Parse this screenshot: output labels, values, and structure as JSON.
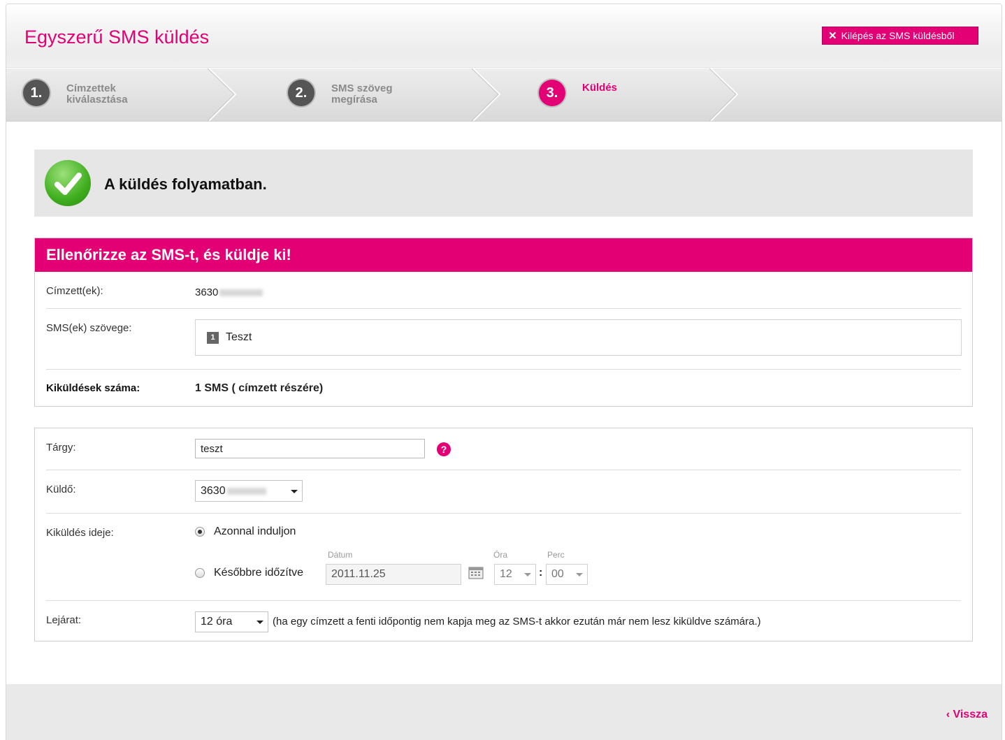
{
  "header": {
    "title": "Egyszerű SMS küldés",
    "exit_label": "Kilépés az SMS küldésből"
  },
  "steps": [
    {
      "number": "1.",
      "label_line1": "Címzettek",
      "label_line2": "kiválasztása",
      "active": false
    },
    {
      "number": "2.",
      "label_line1": "SMS szöveg",
      "label_line2": "megírása",
      "active": false
    },
    {
      "number": "3.",
      "label_line1": "Küldés",
      "label_line2": "",
      "active": true
    }
  ],
  "status": {
    "message": "A küldés folyamatban."
  },
  "review": {
    "heading": "Ellenőrizze az SMS-t, és küldje ki!",
    "recipients_label": "Címzett(ek):",
    "recipients_value": "3630",
    "sms_text_label": "SMS(ek) szövege:",
    "sms_index": "1",
    "sms_text": "Teszt",
    "count_label": "Kiküldések száma:",
    "count_value": "1 SMS ( címzett részére)"
  },
  "form": {
    "subject_label": "Tárgy:",
    "subject_value": "teszt",
    "help_icon": "?",
    "sender_label": "Küldő:",
    "sender_value": "3630",
    "send_time_label": "Kiküldés ideje:",
    "option_now": "Azonnal induljon",
    "option_later": "Későbbre időzítve",
    "selected_option": "now",
    "date_caption": "Dátum",
    "date_value": "2011.11.25",
    "hour_caption": "Óra",
    "hour_value": "12",
    "minute_caption": "Perc",
    "minute_value": "00",
    "time_separator": ":",
    "expiry_label": "Lejárat:",
    "expiry_value": "12 óra",
    "expiry_note": "(ha egy címzett a fenti időpontig nem kapja meg az SMS-t akkor ezután már nem lesz kiküldve számára.)"
  },
  "footer": {
    "back_label": "Vissza",
    "back_icon": "‹"
  },
  "colors": {
    "accent": "#e20074",
    "success": "#3fae1e",
    "panel_gray": "#e6e6e6"
  }
}
